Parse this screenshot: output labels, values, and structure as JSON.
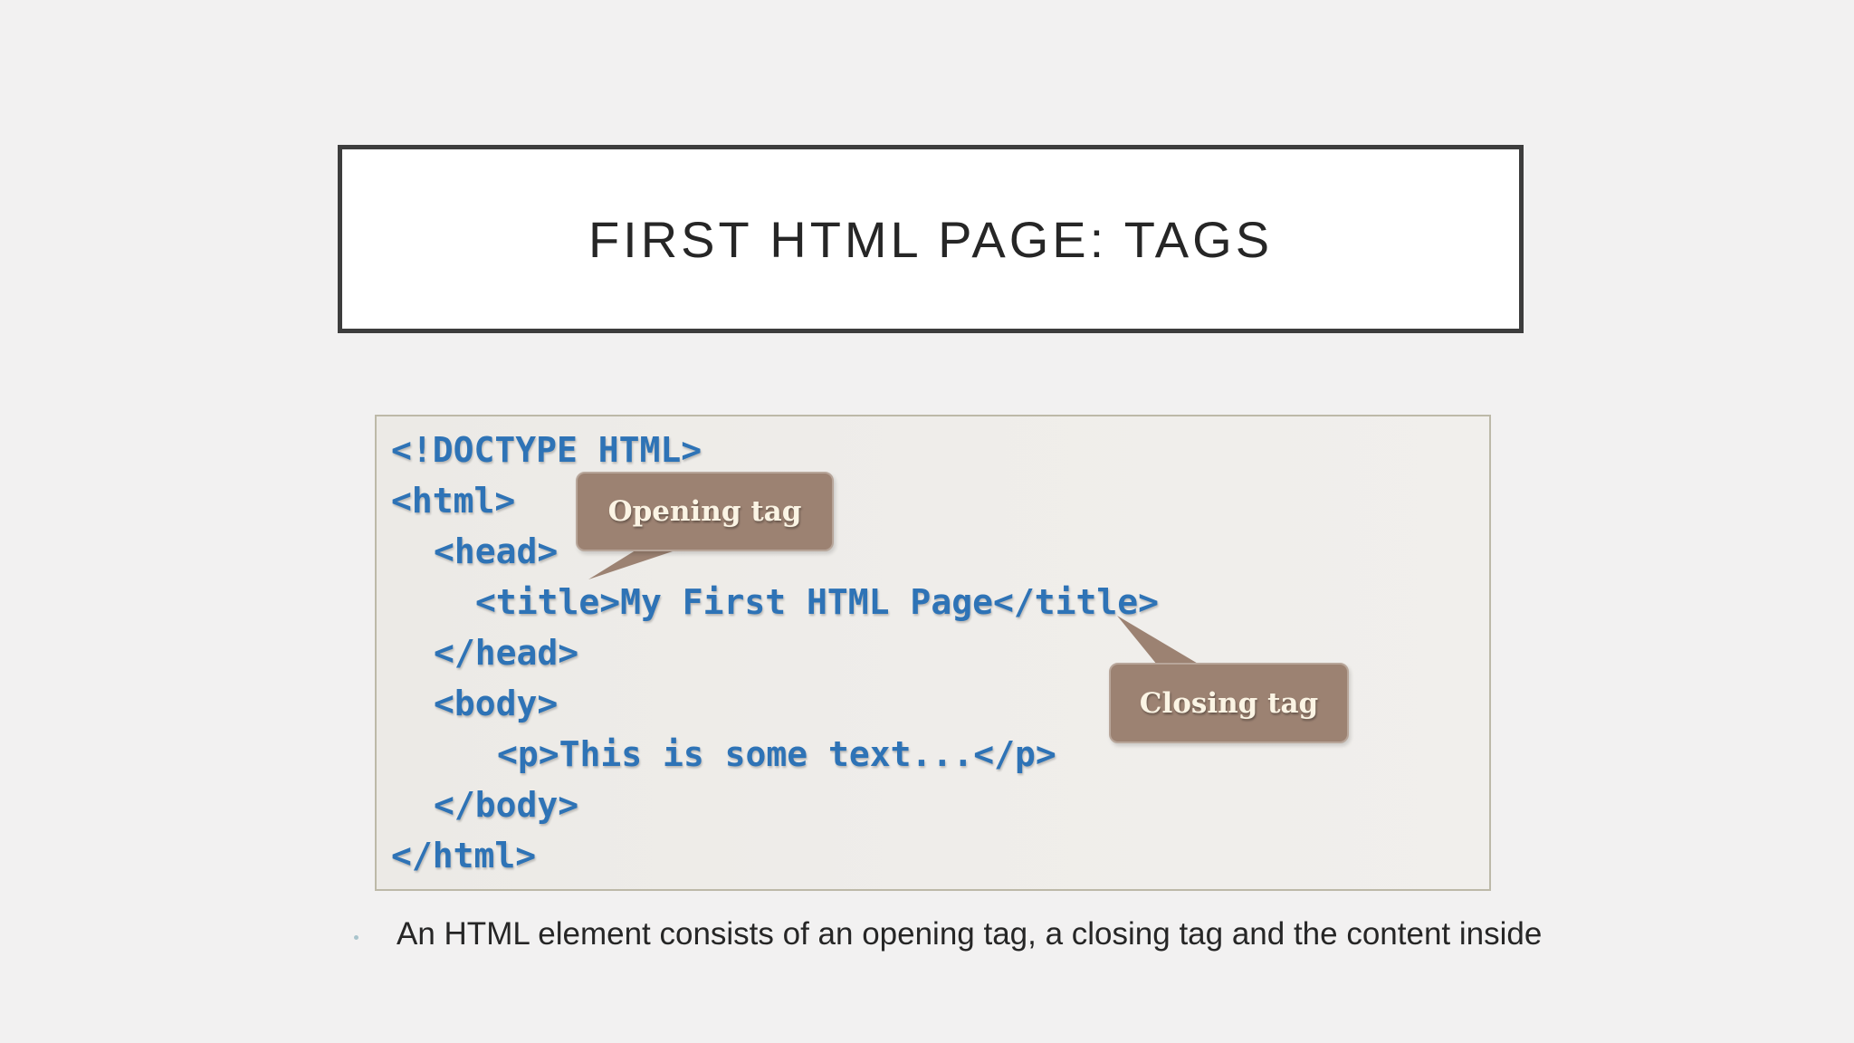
{
  "slide": {
    "title": "FIRST HTML PAGE: TAGS"
  },
  "code": {
    "lines": [
      "<!DOCTYPE HTML>",
      "<html>",
      "<head>",
      "<title>My First HTML Page</title>",
      "</head>",
      "<body>",
      "<p>This is some text...</p>",
      "</body>",
      "</html>"
    ]
  },
  "callouts": {
    "opening": "Opening tag",
    "closing": "Closing tag"
  },
  "bullets": [
    "An HTML element consists of an opening tag, a closing tag and the content inside"
  ],
  "colors": {
    "code_text": "#2e73b6",
    "callout_fill": "#9c8272",
    "callout_text": "#fbf4e4",
    "background": "#f2f1f1"
  }
}
